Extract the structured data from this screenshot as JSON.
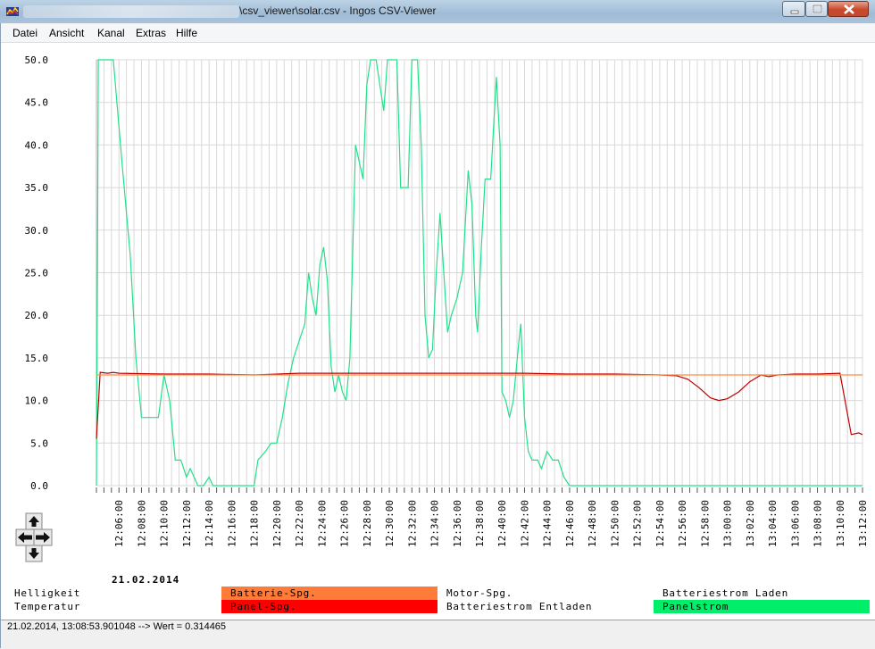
{
  "window": {
    "title": "\\csv_viewer\\solar.csv - Ingos CSV-Viewer",
    "accent": "#9fbbd6"
  },
  "menu": [
    "Datei",
    "Ansicht",
    "Kanal",
    "Extras",
    "Hilfe"
  ],
  "date_label": "21.02.2014",
  "legend": {
    "row1": [
      {
        "label": "Helligkeit",
        "color": ""
      },
      {
        "label": "Batterie-Spg.",
        "color": "#ff7b3a"
      },
      {
        "label": "Motor-Spg.",
        "color": ""
      },
      {
        "label": "Batteriestrom Laden",
        "color": ""
      }
    ],
    "row2": [
      {
        "label": "Temperatur",
        "color": ""
      },
      {
        "label": "Panel-Spg.",
        "color": "#ff0000"
      },
      {
        "label": "Batteriestrom Entladen",
        "color": ""
      },
      {
        "label": "Panelstrom",
        "color": "#00ee6a"
      }
    ]
  },
  "nav_icons": [
    "arrow-up-icon",
    "arrow-left-icon",
    "arrow-right-icon",
    "arrow-down-icon"
  ],
  "status": {
    "text": "21.02.2014, 13:08:53.901048 --> Wert = 0.314465"
  },
  "chart_data": {
    "type": "line",
    "ylim": [
      0,
      50
    ],
    "y_ticks": [
      "0.0",
      "5.0",
      "10.0",
      "15.0",
      "20.0",
      "25.0",
      "30.0",
      "35.0",
      "40.0",
      "45.0",
      "50.0"
    ],
    "x_range": [
      "12:04:00",
      "13:12:00"
    ],
    "x_ticks": [
      "12:06:00",
      "12:08:00",
      "12:10:00",
      "12:12:00",
      "12:14:00",
      "12:16:00",
      "12:18:00",
      "12:20:00",
      "12:22:00",
      "12:24:00",
      "12:26:00",
      "12:28:00",
      "12:30:00",
      "12:32:00",
      "12:34:00",
      "12:36:00",
      "12:38:00",
      "12:40:00",
      "12:42:00",
      "12:44:00",
      "12:46:00",
      "12:48:00",
      "12:50:00",
      "12:52:00",
      "12:54:00",
      "12:56:00",
      "12:58:00",
      "13:00:00",
      "13:02:00",
      "13:04:00",
      "13:06:00",
      "13:08:00",
      "13:10:00",
      "13:12:00"
    ],
    "grid": true,
    "series": [
      {
        "name": "Panelstrom",
        "color": "#22e089",
        "points": [
          [
            "12:04:00",
            0
          ],
          [
            "12:04:05",
            24
          ],
          [
            "12:04:10",
            50
          ],
          [
            "12:04:45",
            50
          ],
          [
            "12:05:30",
            50
          ],
          [
            "12:06:20",
            37
          ],
          [
            "12:07:00",
            27
          ],
          [
            "12:07:30",
            15
          ],
          [
            "12:08:00",
            8
          ],
          [
            "12:08:45",
            8
          ],
          [
            "12:09:30",
            8
          ],
          [
            "12:10:00",
            13
          ],
          [
            "12:10:30",
            10
          ],
          [
            "12:11:00",
            3
          ],
          [
            "12:11:30",
            3
          ],
          [
            "12:12:00",
            1
          ],
          [
            "12:12:20",
            2
          ],
          [
            "12:12:40",
            1
          ],
          [
            "12:13:00",
            0
          ],
          [
            "12:13:30",
            0
          ],
          [
            "12:14:00",
            1
          ],
          [
            "12:14:20",
            0
          ],
          [
            "12:15:00",
            0
          ],
          [
            "12:16:00",
            0
          ],
          [
            "12:17:00",
            0
          ],
          [
            "12:18:00",
            0
          ],
          [
            "12:18:20",
            3
          ],
          [
            "12:19:00",
            4
          ],
          [
            "12:19:30",
            5
          ],
          [
            "12:20:00",
            5
          ],
          [
            "12:20:30",
            8
          ],
          [
            "12:21:00",
            12
          ],
          [
            "12:21:30",
            15
          ],
          [
            "12:22:00",
            17
          ],
          [
            "12:22:30",
            19
          ],
          [
            "12:22:50",
            25
          ],
          [
            "12:23:10",
            22
          ],
          [
            "12:23:30",
            20
          ],
          [
            "12:23:50",
            26
          ],
          [
            "12:24:10",
            28
          ],
          [
            "12:24:30",
            24
          ],
          [
            "12:24:50",
            14
          ],
          [
            "12:25:10",
            11
          ],
          [
            "12:25:30",
            13
          ],
          [
            "12:25:50",
            11
          ],
          [
            "12:26:10",
            10
          ],
          [
            "12:26:30",
            15
          ],
          [
            "12:27:00",
            40
          ],
          [
            "12:27:20",
            38
          ],
          [
            "12:27:40",
            36
          ],
          [
            "12:28:00",
            47
          ],
          [
            "12:28:20",
            50
          ],
          [
            "12:28:50",
            50
          ],
          [
            "12:29:10",
            47
          ],
          [
            "12:29:30",
            44
          ],
          [
            "12:29:50",
            50
          ],
          [
            "12:30:20",
            50
          ],
          [
            "12:30:40",
            50
          ],
          [
            "12:31:00",
            35
          ],
          [
            "12:31:20",
            35
          ],
          [
            "12:31:40",
            35
          ],
          [
            "12:32:00",
            50
          ],
          [
            "12:32:30",
            50
          ],
          [
            "12:32:50",
            40
          ],
          [
            "12:33:10",
            20
          ],
          [
            "12:33:30",
            15
          ],
          [
            "12:33:50",
            16
          ],
          [
            "12:34:10",
            25
          ],
          [
            "12:34:30",
            32
          ],
          [
            "12:34:50",
            25
          ],
          [
            "12:35:10",
            18
          ],
          [
            "12:35:30",
            20
          ],
          [
            "12:36:00",
            22
          ],
          [
            "12:36:30",
            25
          ],
          [
            "12:37:00",
            37
          ],
          [
            "12:37:20",
            33
          ],
          [
            "12:37:40",
            20
          ],
          [
            "12:37:50",
            18
          ],
          [
            "12:38:10",
            28
          ],
          [
            "12:38:30",
            36
          ],
          [
            "12:39:00",
            36
          ],
          [
            "12:39:30",
            48
          ],
          [
            "12:39:50",
            40
          ],
          [
            "12:40:00",
            11
          ],
          [
            "12:40:20",
            10
          ],
          [
            "12:40:40",
            8
          ],
          [
            "12:41:00",
            10
          ],
          [
            "12:41:30",
            17
          ],
          [
            "12:41:40",
            19
          ],
          [
            "12:42:00",
            8
          ],
          [
            "12:42:20",
            4
          ],
          [
            "12:42:40",
            3
          ],
          [
            "12:43:10",
            3
          ],
          [
            "12:43:30",
            2
          ],
          [
            "12:44:00",
            4
          ],
          [
            "12:44:30",
            3
          ],
          [
            "12:45:00",
            3
          ],
          [
            "12:45:30",
            1
          ],
          [
            "12:46:00",
            0
          ],
          [
            "12:48:00",
            0
          ],
          [
            "12:52:00",
            0
          ],
          [
            "12:56:00",
            0
          ],
          [
            "13:00:00",
            0
          ],
          [
            "13:04:00",
            0
          ],
          [
            "13:08:00",
            0
          ],
          [
            "13:12:00",
            0
          ]
        ]
      },
      {
        "name": "Panel-Spg.",
        "color": "#c00000",
        "points": [
          [
            "12:04:00",
            5.5
          ],
          [
            "12:04:20",
            13.3
          ],
          [
            "12:05:00",
            13.2
          ],
          [
            "12:05:30",
            13.3
          ],
          [
            "12:06:00",
            13.2
          ],
          [
            "12:10:00",
            13.1
          ],
          [
            "12:14:00",
            13.1
          ],
          [
            "12:18:00",
            13.0
          ],
          [
            "12:22:00",
            13.2
          ],
          [
            "12:26:00",
            13.2
          ],
          [
            "12:30:00",
            13.2
          ],
          [
            "12:34:00",
            13.2
          ],
          [
            "12:38:00",
            13.2
          ],
          [
            "12:42:00",
            13.2
          ],
          [
            "12:46:00",
            13.1
          ],
          [
            "12:50:00",
            13.1
          ],
          [
            "12:54:00",
            13.0
          ],
          [
            "12:55:30",
            12.9
          ],
          [
            "12:56:30",
            12.5
          ],
          [
            "12:57:30",
            11.5
          ],
          [
            "12:58:30",
            10.3
          ],
          [
            "12:59:15",
            10.0
          ],
          [
            "13:00:00",
            10.2
          ],
          [
            "13:01:00",
            11.0
          ],
          [
            "13:02:00",
            12.2
          ],
          [
            "13:03:00",
            13.0
          ],
          [
            "13:03:40",
            12.8
          ],
          [
            "13:04:30",
            13.0
          ],
          [
            "13:06:00",
            13.1
          ],
          [
            "13:08:00",
            13.1
          ],
          [
            "13:10:00",
            13.2
          ],
          [
            "13:11:00",
            6.0
          ],
          [
            "13:11:40",
            6.2
          ],
          [
            "13:12:00",
            6.0
          ]
        ]
      },
      {
        "name": "Batterie-Spg.",
        "color": "#ff8c42",
        "points": [
          [
            "12:04:00",
            13.0
          ],
          [
            "13:12:00",
            13.0
          ]
        ]
      }
    ]
  }
}
